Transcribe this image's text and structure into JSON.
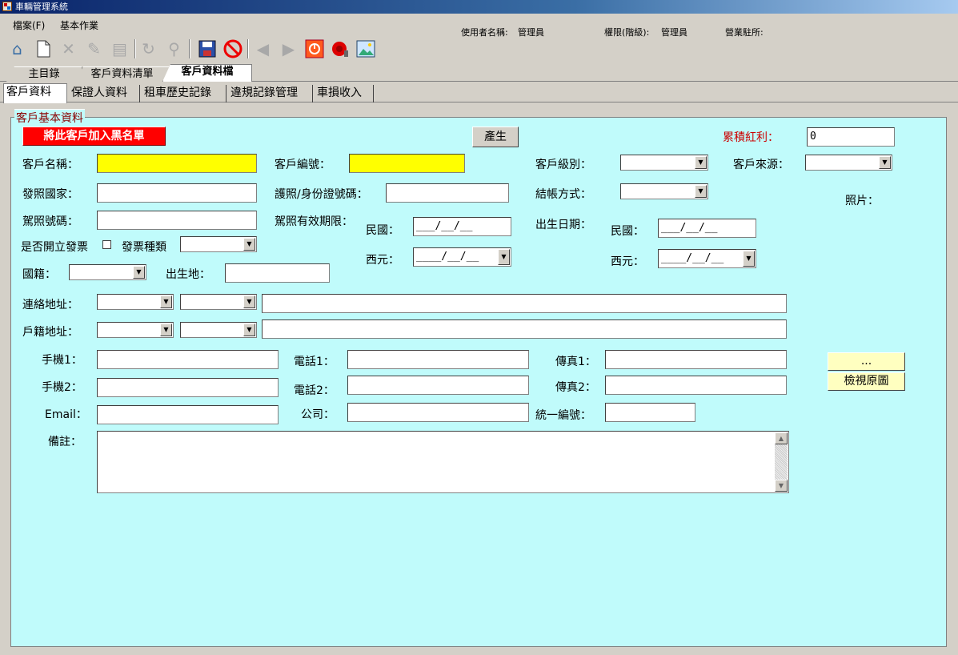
{
  "window": {
    "title": "車輛管理系統"
  },
  "menu": {
    "file": "檔案(F)",
    "basic": "基本作業"
  },
  "status": {
    "user_label": "使用者名稱:",
    "user_value": "管理員",
    "role_label": "權限(階級):",
    "role_value": "管理員",
    "branch_label": "營業駐所:"
  },
  "toolbar": {
    "icons": [
      "home-icon",
      "new-icon",
      "delete-icon",
      "edit-icon",
      "print-icon",
      "refresh-icon",
      "search-icon",
      "save-icon",
      "cancel-icon",
      "back-icon",
      "forward-icon",
      "power-icon",
      "alarm-icon",
      "image-icon"
    ]
  },
  "tabs_main": [
    "主目錄",
    "客戶資料清單",
    "客戶資料檔"
  ],
  "tabs_sub": [
    "客戶資料",
    "保證人資料",
    "租車歷史記錄",
    "違規記錄管理",
    "車損收入"
  ],
  "group_title": "客戶基本資料",
  "form": {
    "blacklist_button": "將此客戶加入黑名單",
    "generate_button": "產生",
    "bonus_label": "累積紅利：",
    "bonus_value": "0",
    "name_label": "客戶名稱：",
    "id_label": "客戶編號：",
    "level_label": "客戶級別：",
    "source_label": "客戶來源：",
    "country_label": "發照國家：",
    "passport_label": "護照/身份證號碼：",
    "billing_label": "結帳方式：",
    "photo_label": "照片：",
    "license_label": "駕照號碼：",
    "license_exp_label": "駕照有效期限：",
    "roc_label": "民國：",
    "roc_date_placeholder": "___/__/__",
    "ad_label": "西元：",
    "ad_date_placeholder": "____/__/__",
    "birth_label": "出生日期：",
    "invoice_label": "是否開立發票",
    "invoice_type_label": "發票種類",
    "nationality_label": "國籍：",
    "birthplace_label": "出生地：",
    "contact_addr_label": "連絡地址：",
    "reg_addr_label": "戶籍地址：",
    "mobile1_label": "手機1：",
    "phone1_label": "電話1：",
    "fax1_label": "傳真1：",
    "mobile2_label": "手機2：",
    "phone2_label": "電話2：",
    "fax2_label": "傳真2：",
    "email_label": "Email：",
    "company_label": "公司：",
    "taxid_label": "統一編號：",
    "note_label": "備註：",
    "browse_button": "...",
    "view_original_button": "檢視原圖"
  },
  "colors": {
    "panel_bg": "#c0fbfb",
    "required_field": "#ffff00",
    "blacklist_button": "#ff0000",
    "bonus_label": "#cc0000"
  }
}
